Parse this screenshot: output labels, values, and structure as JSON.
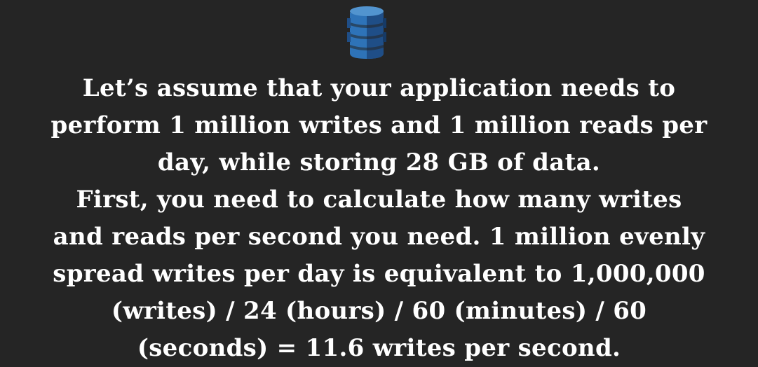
{
  "logo": {
    "icon": "dynamodb-icon",
    "colors": {
      "primary": "#2E73B8",
      "dark": "#1F4E87",
      "light": "#5294CF"
    }
  },
  "lines": [
    "Let’s assume that your application needs to",
    "perform 1 million writes and 1 million reads per",
    "day, while storing 28 GB of data.",
    "First, you need to calculate how many writes",
    "and reads per second you need. 1 million evenly",
    "spread writes per day is equivalent to 1,000,000",
    "(writes) / 24 (hours) / 60 (minutes) / 60",
    "(seconds) = 11.6 writes per second."
  ]
}
